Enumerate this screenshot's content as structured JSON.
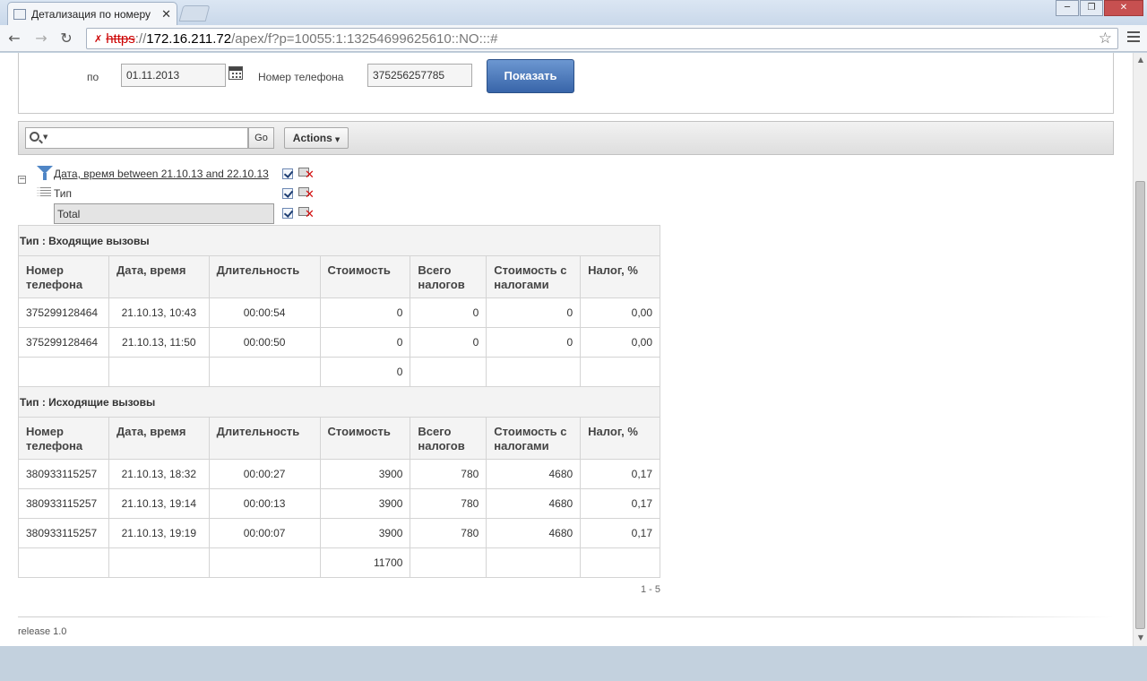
{
  "browser": {
    "tab_title": "Детализация по номеру",
    "tab_close": "✕",
    "url_https": "https",
    "url_sep": "://",
    "url_host": "172.16.211.72",
    "url_path": "/apex/f?p=10055:1:13254699625610::NO:::#",
    "window_buttons": [
      "─",
      "❐",
      "✕"
    ]
  },
  "filter": {
    "label_to": "по",
    "date_to": "01.11.2013",
    "label_phone": "Номер телефона",
    "phone": "375256257785",
    "show_button": "Показать"
  },
  "toolbar": {
    "search_value": "",
    "go_label": "Go",
    "actions_label": "Actions"
  },
  "control_panel": {
    "collapse": "−",
    "filter_text": "Дата, время between 21.10.13 and 22.10.13",
    "break_label": "Тип",
    "total_label": "Total"
  },
  "report": {
    "columns": [
      "Номер телефона",
      "Дата, время",
      "Длительность",
      "Стоимость",
      "Всего налогов",
      "Стоимость с налогами",
      "Налог, %"
    ],
    "groups": [
      {
        "title": "Тип : Входящие вызовы",
        "rows": [
          [
            "375299128464",
            "21.10.13, 10:43",
            "00:00:54",
            "0",
            "0",
            "0",
            "0,00"
          ],
          [
            "375299128464",
            "21.10.13, 11:50",
            "00:00:50",
            "0",
            "0",
            "0",
            "0,00"
          ]
        ],
        "total": "0"
      },
      {
        "title": "Тип : Исходящие вызовы",
        "rows": [
          [
            "380933115257",
            "21.10.13, 18:32",
            "00:00:27",
            "3900",
            "780",
            "4680",
            "0,17"
          ],
          [
            "380933115257",
            "21.10.13, 19:14",
            "00:00:13",
            "3900",
            "780",
            "4680",
            "0,17"
          ],
          [
            "380933115257",
            "21.10.13, 19:19",
            "00:00:07",
            "3900",
            "780",
            "4680",
            "0,17"
          ]
        ],
        "total": "11700"
      }
    ],
    "pagination": "1 - 5"
  },
  "footer": {
    "release": "release 1.0"
  }
}
